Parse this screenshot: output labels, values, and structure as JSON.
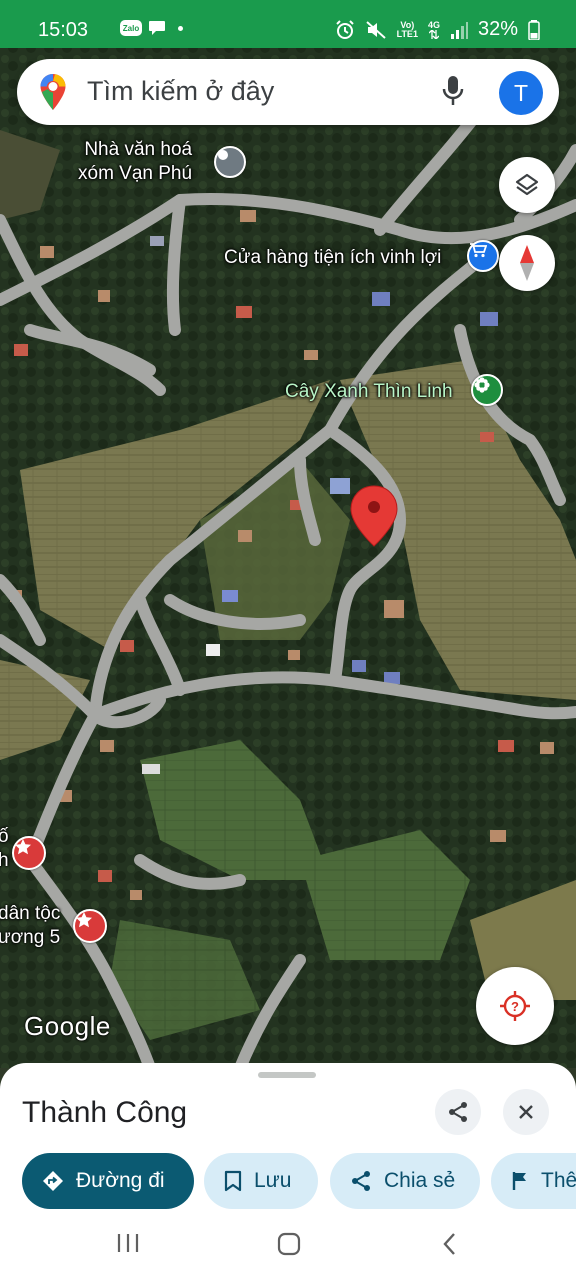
{
  "status_bar": {
    "time": "15:03",
    "apps": [
      "Zalo",
      "chat-bubble-icon"
    ],
    "network_top": "Vo)",
    "network_bottom": "LTE1",
    "signal_label": "4G",
    "battery": "32%"
  },
  "search": {
    "placeholder": "Tìm kiếm ở đây",
    "avatar_letter": "T"
  },
  "map_labels": {
    "culture_house": [
      "Nhà văn hoá",
      "xóm Vạn Phú"
    ],
    "store": "Cửa hàng tiện ích vinh lợi",
    "tree_shop": "Cây Xanh Thìn Linh",
    "left_edge_1": [
      "ố",
      "h"
    ],
    "left_edge_2": [
      "dân tộc",
      "ương 5"
    ]
  },
  "watermark": "Google",
  "place": {
    "name": "Thành Công"
  },
  "actions": {
    "directions": "Đường đi",
    "save": "Lưu",
    "share": "Chia sẻ",
    "more": "Thê"
  },
  "colors": {
    "status_green": "#1a9b4d",
    "pin_red": "#e53935",
    "road": "#a6a7a4",
    "primary_chip": "#0b5a72",
    "chip_bg": "#d7ecf7",
    "avatar": "#1a73e8"
  }
}
